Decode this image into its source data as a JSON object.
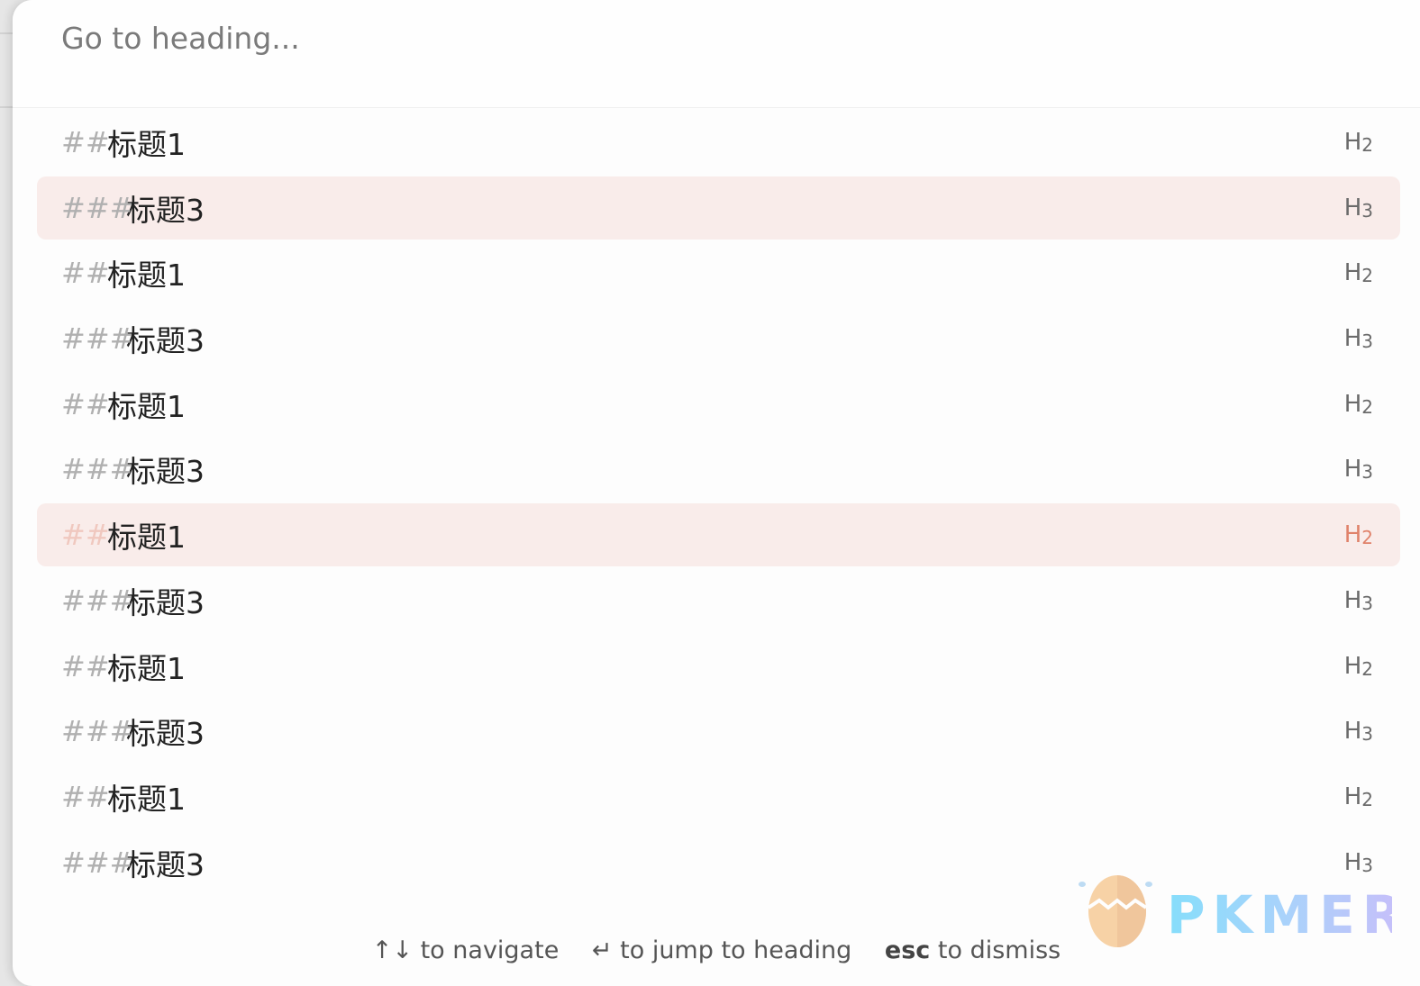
{
  "search": {
    "placeholder": "Go to heading..."
  },
  "accent_color": "#e0826a",
  "highlight_color": "#f9ecea",
  "headings": [
    {
      "marker": "##",
      "text": "标题1",
      "level": "H",
      "level_num": "2",
      "state": "normal"
    },
    {
      "marker": "###",
      "text": "标题3",
      "level": "H",
      "level_num": "3",
      "state": "hover"
    },
    {
      "marker": "##",
      "text": "标题1",
      "level": "H",
      "level_num": "2",
      "state": "normal"
    },
    {
      "marker": "###",
      "text": "标题3",
      "level": "H",
      "level_num": "3",
      "state": "normal"
    },
    {
      "marker": "##",
      "text": "标题1",
      "level": "H",
      "level_num": "2",
      "state": "normal"
    },
    {
      "marker": "###",
      "text": "标题3",
      "level": "H",
      "level_num": "3",
      "state": "normal"
    },
    {
      "marker": "##",
      "text": "标题1",
      "level": "H",
      "level_num": "2",
      "state": "selected"
    },
    {
      "marker": "###",
      "text": "标题3",
      "level": "H",
      "level_num": "3",
      "state": "normal"
    },
    {
      "marker": "##",
      "text": "标题1",
      "level": "H",
      "level_num": "2",
      "state": "normal"
    },
    {
      "marker": "###",
      "text": "标题3",
      "level": "H",
      "level_num": "3",
      "state": "normal"
    },
    {
      "marker": "##",
      "text": "标题1",
      "level": "H",
      "level_num": "2",
      "state": "normal"
    },
    {
      "marker": "###",
      "text": "标题3",
      "level": "H",
      "level_num": "3",
      "state": "normal"
    }
  ],
  "footer": {
    "nav_keys": "↑↓",
    "nav_label": "to navigate",
    "enter_key": "↵",
    "enter_label": "to jump to heading",
    "esc_key": "esc",
    "esc_label": "to dismiss"
  },
  "watermark": {
    "text": "PKMER",
    "icon": "egg-logo-icon"
  }
}
